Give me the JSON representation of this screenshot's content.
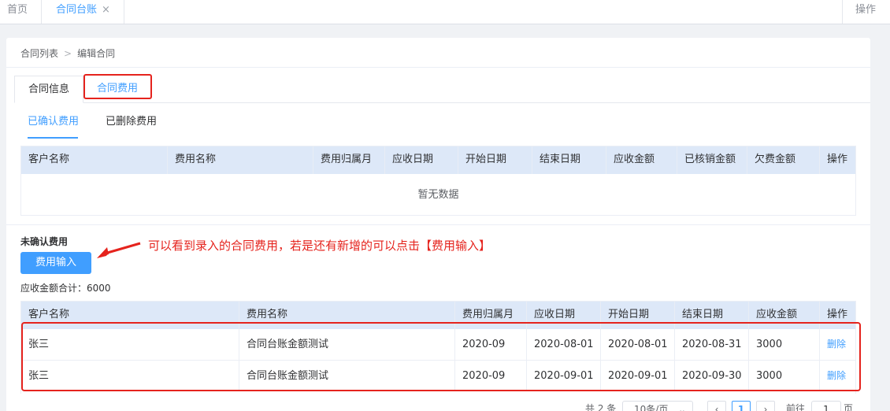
{
  "top_tabs": {
    "home": "首页",
    "contract_ledger": "合同台账",
    "close_glyph": "×",
    "operations": "操作"
  },
  "breadcrumb": {
    "list": "合同列表",
    "separator": ">",
    "current": "编辑合同"
  },
  "card_tabs": {
    "info": "合同信息",
    "fees": "合同费用"
  },
  "sub_tabs": {
    "confirmed": "已确认费用",
    "deleted": "已删除费用"
  },
  "confirmed_table": {
    "headers": [
      "客户名称",
      "费用名称",
      "费用归属月",
      "应收日期",
      "开始日期",
      "结束日期",
      "应收金额",
      "已核销金额",
      "欠费金额",
      "操作"
    ],
    "empty_text": "暂无数据"
  },
  "unconfirmed": {
    "title": "未确认费用",
    "add_button": "费用输入",
    "total_label": "应收金额合计：6000"
  },
  "annotation": "可以看到录入的合同费用，若是还有新增的可以点击【费用输入】",
  "unconfirmed_table": {
    "headers": [
      "客户名称",
      "费用名称",
      "费用归属月",
      "应收日期",
      "开始日期",
      "结束日期",
      "应收金额",
      "操作"
    ],
    "rows": [
      {
        "customer": "张三",
        "fee_name": "合同台账金额测试",
        "month": "2020-09",
        "due": "2020-08-01",
        "start": "2020-08-01",
        "end": "2020-08-31",
        "amount": "3000",
        "action": "删除"
      },
      {
        "customer": "张三",
        "fee_name": "合同台账金额测试",
        "month": "2020-09",
        "due": "2020-09-01",
        "start": "2020-09-01",
        "end": "2020-09-30",
        "amount": "3000",
        "action": "删除"
      }
    ]
  },
  "pagination": {
    "total": "共 2 条",
    "page_size": "10条/页",
    "prev": "‹",
    "current_page": "1",
    "next": "›",
    "goto": "前往",
    "goto_value": "1",
    "page_unit": "页"
  },
  "colors": {
    "primary": "#409eff",
    "annotation_red": "#e5231d",
    "header_bg": "#dde8f8"
  },
  "icons": [
    "close-icon",
    "chevron-right-icon",
    "arrow-annotation-icon",
    "chevron-down-icon",
    "prev-icon",
    "next-icon"
  ]
}
